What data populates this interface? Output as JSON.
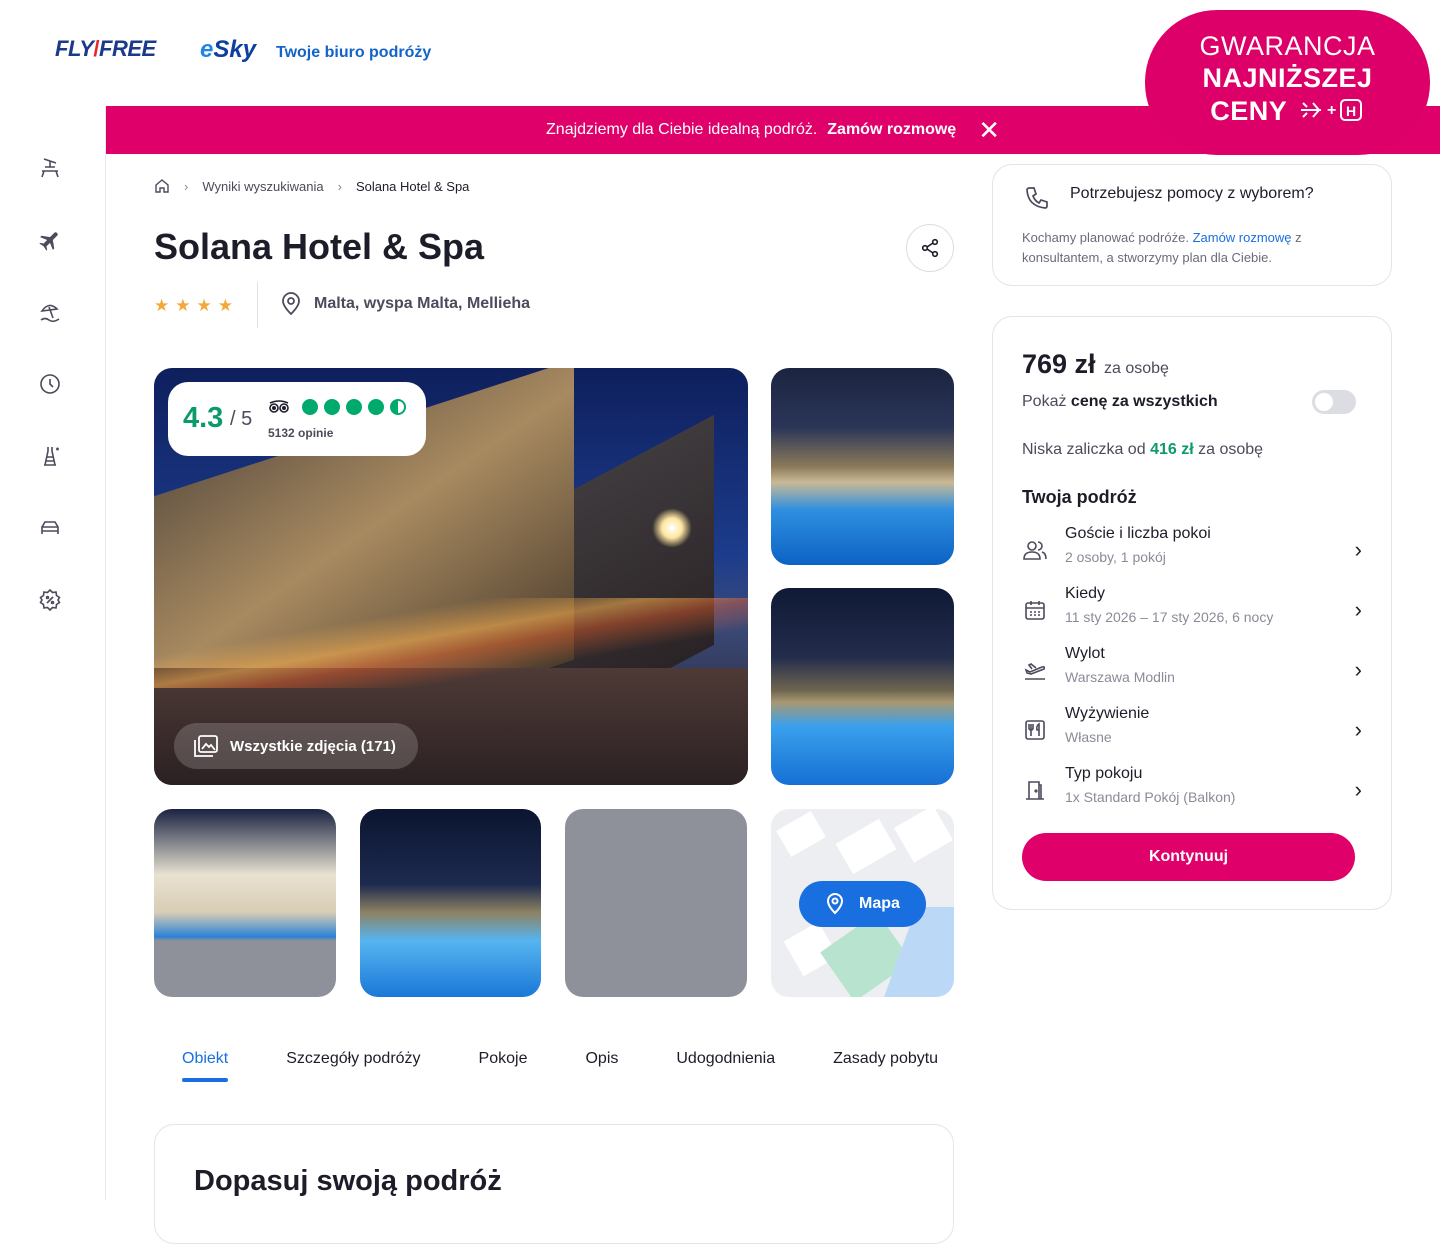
{
  "header": {
    "logo_fly": "FLY",
    "logo_free": "FREE",
    "logo_esky": "Sky",
    "logo_esky_e": "e",
    "tagline": "Twoje biuro podróży"
  },
  "badge": {
    "line1": "GWARANCJA",
    "line2": "NAJNIŻSZEJ",
    "line3": "CENY"
  },
  "banner": {
    "text": "Znajdziemy dla Ciebie idealną podróż.",
    "cta": "Zamów rozmowę",
    "close": "✕"
  },
  "breadcrumb": {
    "items": [
      "Wyniki wyszukiwania",
      "Solana Hotel & Spa"
    ],
    "separator": "›"
  },
  "hotel": {
    "name": "Solana Hotel & Spa",
    "stars": "★★★★",
    "location": "Malta, wyspa Malta, Mellieha"
  },
  "rating": {
    "score": "4.3",
    "out_of": "/ 5",
    "reviews": "5132 opinie",
    "value": 4.3
  },
  "gallery": {
    "all_photos": "Wszystkie zdjęcia (171)",
    "map_label": "Mapa"
  },
  "tabs": [
    "Obiekt",
    "Szczegóły podróży",
    "Pokoje",
    "Opis",
    "Udogodnienia",
    "Zasady pobytu"
  ],
  "section": {
    "title": "Dopasuj swoją podróż"
  },
  "help": {
    "title": "Potrzebujesz pomocy z wyborem?",
    "text_before": "Kochamy planować podróże.",
    "link": "Zamów rozmowę",
    "text_after": "z konsultantem, a stworzymy plan dla Ciebie."
  },
  "booking": {
    "price": "769 zł",
    "price_unit": "za osobę",
    "toggle_prefix": "Pokaż",
    "toggle_bold": "cenę za wszystkich",
    "deposit_prefix": "Niska zaliczka od",
    "deposit_value": "416 zł",
    "deposit_suffix": "za osobę",
    "trip_heading": "Twoja podróż",
    "rows": [
      {
        "title": "Goście i liczba pokoi",
        "sub": "2 osoby, 1 pokój",
        "icon": "people-icon"
      },
      {
        "title": "Kiedy",
        "sub": "11 sty 2026 – 17 sty 2026, 6 nocy",
        "icon": "calendar-icon"
      },
      {
        "title": "Wylot",
        "sub": "Warszawa Modlin",
        "icon": "plane-departure-icon"
      },
      {
        "title": "Wyżywienie",
        "sub": "Własne",
        "icon": "cutlery-icon"
      },
      {
        "title": "Typ pokoju",
        "sub": "1x Standard Pokój (Balkon)",
        "icon": "door-icon"
      }
    ],
    "continue": "Kontynuuj"
  },
  "colors": {
    "brand_pink": "#e0006a",
    "accent_blue": "#1a6fe0",
    "green": "#0d9a6b"
  }
}
